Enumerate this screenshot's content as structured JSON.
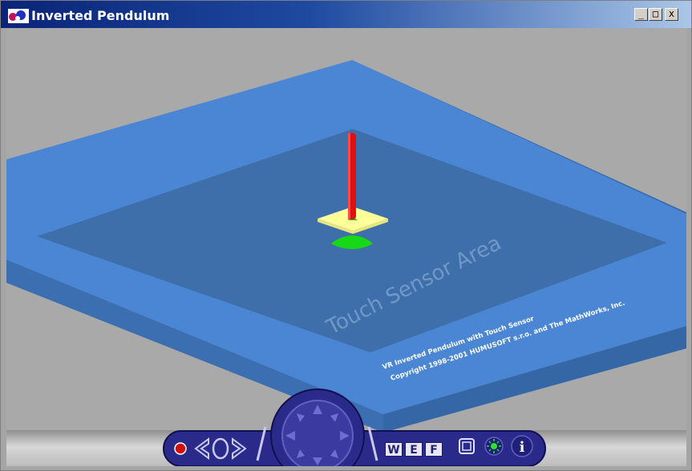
{
  "window": {
    "title": "Inverted Pendulum",
    "minimize_label": "_",
    "maximize_label": "□",
    "close_label": "x"
  },
  "scene": {
    "sensor_label": "Touch Sensor Area",
    "credits_line1": "VR Inverted Pendulum with Touch Sensor",
    "credits_line2": "Copyright 1998-2001 HUMUSOFT s.r.o. and The MathWorks, Inc.",
    "colors": {
      "background": "#a9a9a9",
      "platform": "#4a86d4",
      "sensor_area": "#3f6fab",
      "pendulum": "#e01010",
      "cart": "#ffff99",
      "base": "#16d816"
    }
  },
  "navigator": {
    "walk_label": "W",
    "examine_label": "E",
    "fly_label": "F",
    "info_label": "i"
  }
}
